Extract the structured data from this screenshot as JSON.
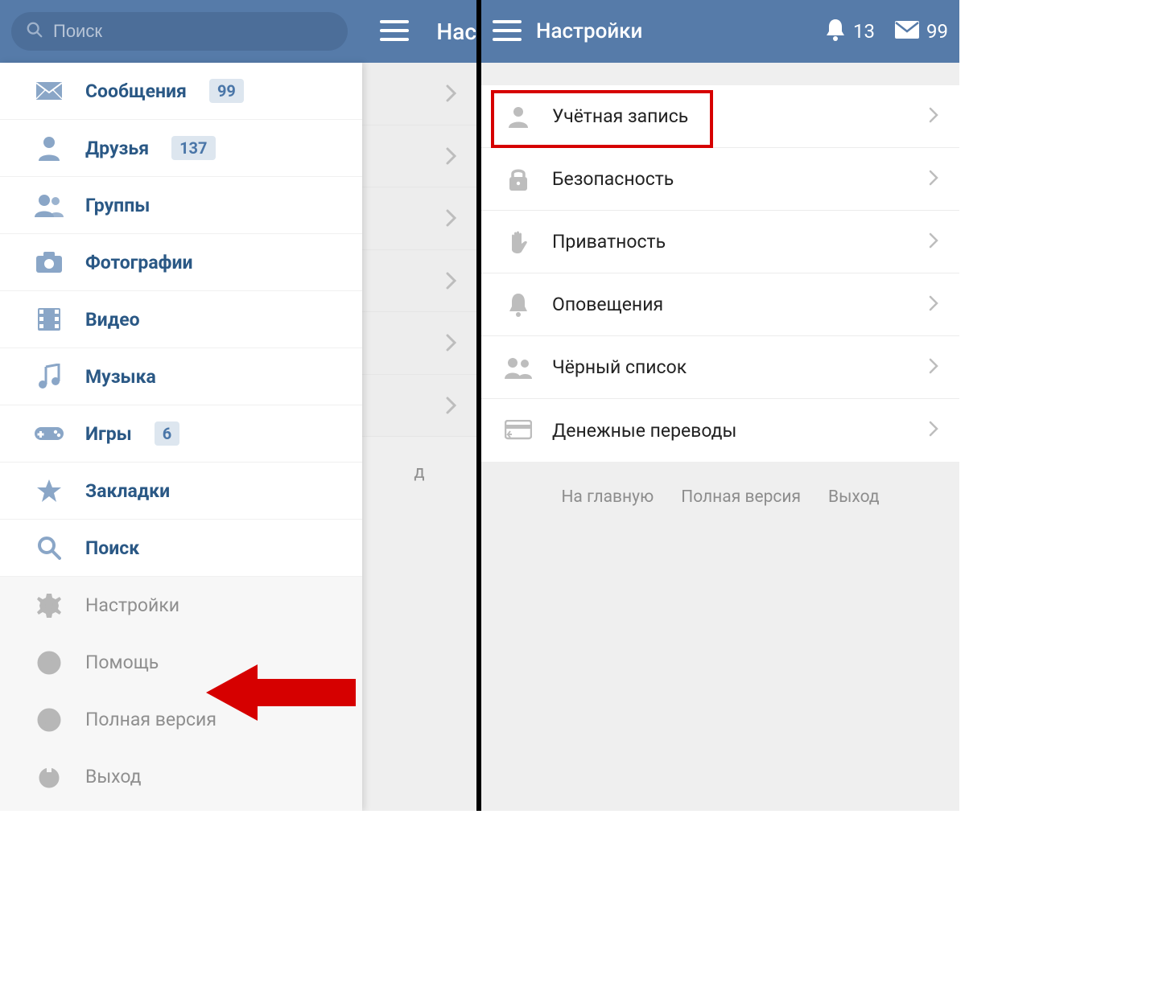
{
  "left": {
    "search_placeholder": "Поиск",
    "partial_title": "Нас",
    "obscured_footer_fragment": "д",
    "menu_main": [
      {
        "key": "messages",
        "label": "Сообщения",
        "badge": "99",
        "icon": "mail-icon"
      },
      {
        "key": "friends",
        "label": "Друзья",
        "badge": "137",
        "icon": "user-icon"
      },
      {
        "key": "groups",
        "label": "Группы",
        "badge": null,
        "icon": "users-icon"
      },
      {
        "key": "photos",
        "label": "Фотографии",
        "badge": null,
        "icon": "camera-icon"
      },
      {
        "key": "video",
        "label": "Видео",
        "badge": null,
        "icon": "film-icon"
      },
      {
        "key": "music",
        "label": "Музыка",
        "badge": null,
        "icon": "music-icon"
      },
      {
        "key": "games",
        "label": "Игры",
        "badge": "6",
        "icon": "gamepad-icon"
      },
      {
        "key": "bookmarks",
        "label": "Закладки",
        "badge": null,
        "icon": "star-icon"
      },
      {
        "key": "search",
        "label": "Поиск",
        "badge": null,
        "icon": "search-icon"
      }
    ],
    "menu_secondary": [
      {
        "key": "settings",
        "label": "Настройки",
        "icon": "gear-icon"
      },
      {
        "key": "help",
        "label": "Помощь",
        "icon": "help-icon"
      },
      {
        "key": "fullversion",
        "label": "Полная версия",
        "icon": "globe-icon"
      },
      {
        "key": "logout",
        "label": "Выход",
        "icon": "power-icon"
      }
    ]
  },
  "right": {
    "title": "Настройки",
    "notifications_count": "13",
    "messages_count": "99",
    "settings_items": [
      {
        "key": "account",
        "label": "Учётная запись",
        "icon": "person-icon",
        "highlight": true
      },
      {
        "key": "security",
        "label": "Безопасность",
        "icon": "lock-icon",
        "highlight": false
      },
      {
        "key": "privacy",
        "label": "Приватность",
        "icon": "hand-icon",
        "highlight": false
      },
      {
        "key": "alerts",
        "label": "Оповещения",
        "icon": "bell-icon",
        "highlight": false
      },
      {
        "key": "blacklist",
        "label": "Чёрный список",
        "icon": "people-icon",
        "highlight": false
      },
      {
        "key": "payments",
        "label": "Денежные переводы",
        "icon": "card-icon",
        "highlight": false
      }
    ],
    "footer_links": [
      "На главную",
      "Полная версия",
      "Выход"
    ]
  },
  "colors": {
    "header": "#567ba9",
    "accent": "#2a5885",
    "annotation": "#d60000"
  }
}
